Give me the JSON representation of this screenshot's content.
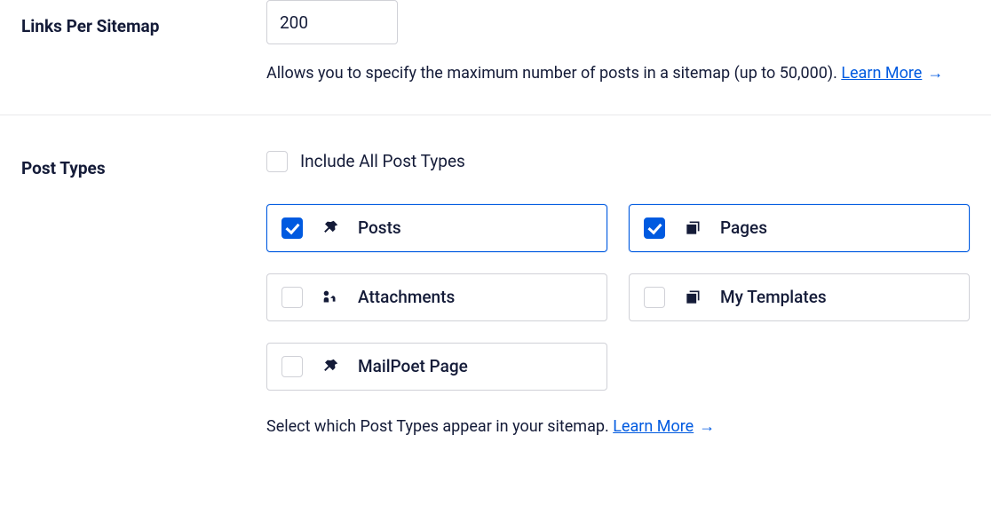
{
  "links_per_sitemap": {
    "label": "Links Per Sitemap",
    "value": "200",
    "help_text": "Allows you to specify the maximum number of posts in a sitemap (up to 50,000). ",
    "learn_more": "Learn More"
  },
  "post_types": {
    "label": "Post Types",
    "include_all_label": "Include All Post Types",
    "include_all_checked": false,
    "cards": [
      {
        "label": "Posts",
        "checked": true,
        "icon": "pin"
      },
      {
        "label": "Pages",
        "checked": true,
        "icon": "stack"
      },
      {
        "label": "Attachments",
        "checked": false,
        "icon": "media"
      },
      {
        "label": "My Templates",
        "checked": false,
        "icon": "stack"
      },
      {
        "label": "MailPoet Page",
        "checked": false,
        "icon": "pin"
      }
    ],
    "help_text": "Select which Post Types appear in your sitemap. ",
    "learn_more": "Learn More"
  }
}
